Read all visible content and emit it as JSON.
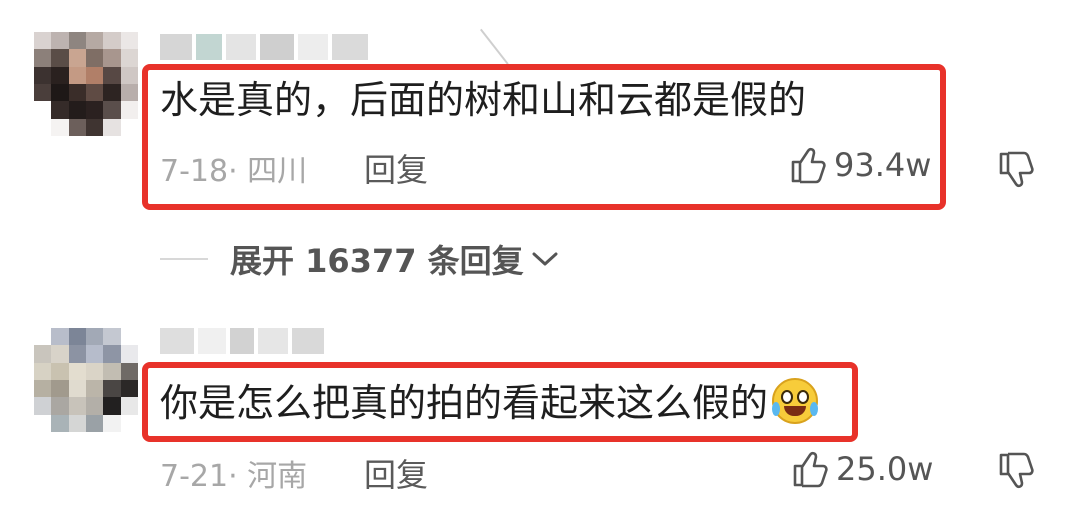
{
  "comments": [
    {
      "text": "水是真的，后面的树和山和云都是假的",
      "date_location": "7-18· 四川",
      "reply_label": "回复",
      "likes": "93.4w"
    },
    {
      "text": "你是怎么把真的拍的看起来这么假的",
      "emoji": "laugh-cry-emoji",
      "date_location": "7-21· 河南",
      "reply_label": "回复",
      "likes": "25.0w"
    }
  ],
  "expand_replies": "展开 16377 条回复",
  "colors": {
    "highlight": "#e8322a",
    "meta_text": "#a7a7a7",
    "body_text": "#1e1e1e"
  },
  "icons": {
    "like": "thumbs-up-icon",
    "dislike": "thumbs-down-icon",
    "expand": "chevron-down-icon"
  }
}
